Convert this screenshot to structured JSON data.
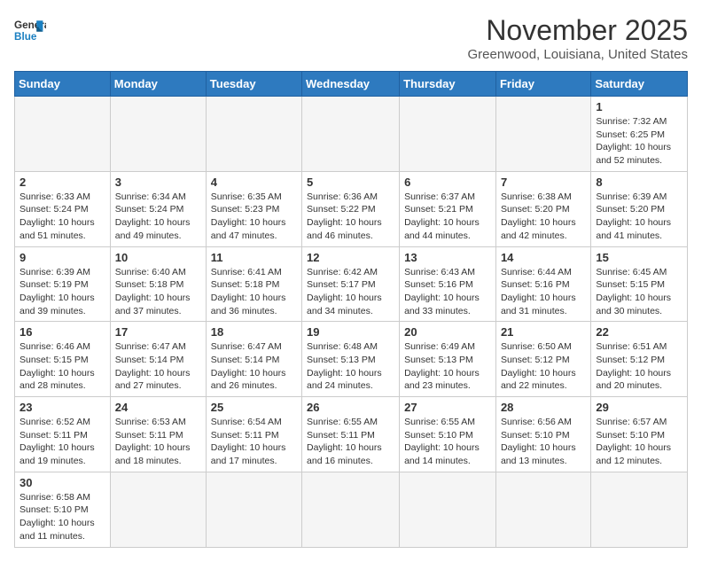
{
  "logo": {
    "line1": "General",
    "line2": "Blue"
  },
  "title": "November 2025",
  "subtitle": "Greenwood, Louisiana, United States",
  "days_of_week": [
    "Sunday",
    "Monday",
    "Tuesday",
    "Wednesday",
    "Thursday",
    "Friday",
    "Saturday"
  ],
  "weeks": [
    [
      {
        "num": "",
        "info": ""
      },
      {
        "num": "",
        "info": ""
      },
      {
        "num": "",
        "info": ""
      },
      {
        "num": "",
        "info": ""
      },
      {
        "num": "",
        "info": ""
      },
      {
        "num": "",
        "info": ""
      },
      {
        "num": "1",
        "info": "Sunrise: 7:32 AM\nSunset: 6:25 PM\nDaylight: 10 hours and 52 minutes."
      }
    ],
    [
      {
        "num": "2",
        "info": "Sunrise: 6:33 AM\nSunset: 5:24 PM\nDaylight: 10 hours and 51 minutes."
      },
      {
        "num": "3",
        "info": "Sunrise: 6:34 AM\nSunset: 5:24 PM\nDaylight: 10 hours and 49 minutes."
      },
      {
        "num": "4",
        "info": "Sunrise: 6:35 AM\nSunset: 5:23 PM\nDaylight: 10 hours and 47 minutes."
      },
      {
        "num": "5",
        "info": "Sunrise: 6:36 AM\nSunset: 5:22 PM\nDaylight: 10 hours and 46 minutes."
      },
      {
        "num": "6",
        "info": "Sunrise: 6:37 AM\nSunset: 5:21 PM\nDaylight: 10 hours and 44 minutes."
      },
      {
        "num": "7",
        "info": "Sunrise: 6:38 AM\nSunset: 5:20 PM\nDaylight: 10 hours and 42 minutes."
      },
      {
        "num": "8",
        "info": "Sunrise: 6:39 AM\nSunset: 5:20 PM\nDaylight: 10 hours and 41 minutes."
      }
    ],
    [
      {
        "num": "9",
        "info": "Sunrise: 6:39 AM\nSunset: 5:19 PM\nDaylight: 10 hours and 39 minutes."
      },
      {
        "num": "10",
        "info": "Sunrise: 6:40 AM\nSunset: 5:18 PM\nDaylight: 10 hours and 37 minutes."
      },
      {
        "num": "11",
        "info": "Sunrise: 6:41 AM\nSunset: 5:18 PM\nDaylight: 10 hours and 36 minutes."
      },
      {
        "num": "12",
        "info": "Sunrise: 6:42 AM\nSunset: 5:17 PM\nDaylight: 10 hours and 34 minutes."
      },
      {
        "num": "13",
        "info": "Sunrise: 6:43 AM\nSunset: 5:16 PM\nDaylight: 10 hours and 33 minutes."
      },
      {
        "num": "14",
        "info": "Sunrise: 6:44 AM\nSunset: 5:16 PM\nDaylight: 10 hours and 31 minutes."
      },
      {
        "num": "15",
        "info": "Sunrise: 6:45 AM\nSunset: 5:15 PM\nDaylight: 10 hours and 30 minutes."
      }
    ],
    [
      {
        "num": "16",
        "info": "Sunrise: 6:46 AM\nSunset: 5:15 PM\nDaylight: 10 hours and 28 minutes."
      },
      {
        "num": "17",
        "info": "Sunrise: 6:47 AM\nSunset: 5:14 PM\nDaylight: 10 hours and 27 minutes."
      },
      {
        "num": "18",
        "info": "Sunrise: 6:47 AM\nSunset: 5:14 PM\nDaylight: 10 hours and 26 minutes."
      },
      {
        "num": "19",
        "info": "Sunrise: 6:48 AM\nSunset: 5:13 PM\nDaylight: 10 hours and 24 minutes."
      },
      {
        "num": "20",
        "info": "Sunrise: 6:49 AM\nSunset: 5:13 PM\nDaylight: 10 hours and 23 minutes."
      },
      {
        "num": "21",
        "info": "Sunrise: 6:50 AM\nSunset: 5:12 PM\nDaylight: 10 hours and 22 minutes."
      },
      {
        "num": "22",
        "info": "Sunrise: 6:51 AM\nSunset: 5:12 PM\nDaylight: 10 hours and 20 minutes."
      }
    ],
    [
      {
        "num": "23",
        "info": "Sunrise: 6:52 AM\nSunset: 5:11 PM\nDaylight: 10 hours and 19 minutes."
      },
      {
        "num": "24",
        "info": "Sunrise: 6:53 AM\nSunset: 5:11 PM\nDaylight: 10 hours and 18 minutes."
      },
      {
        "num": "25",
        "info": "Sunrise: 6:54 AM\nSunset: 5:11 PM\nDaylight: 10 hours and 17 minutes."
      },
      {
        "num": "26",
        "info": "Sunrise: 6:55 AM\nSunset: 5:11 PM\nDaylight: 10 hours and 16 minutes."
      },
      {
        "num": "27",
        "info": "Sunrise: 6:55 AM\nSunset: 5:10 PM\nDaylight: 10 hours and 14 minutes."
      },
      {
        "num": "28",
        "info": "Sunrise: 6:56 AM\nSunset: 5:10 PM\nDaylight: 10 hours and 13 minutes."
      },
      {
        "num": "29",
        "info": "Sunrise: 6:57 AM\nSunset: 5:10 PM\nDaylight: 10 hours and 12 minutes."
      }
    ],
    [
      {
        "num": "30",
        "info": "Sunrise: 6:58 AM\nSunset: 5:10 PM\nDaylight: 10 hours and 11 minutes."
      },
      {
        "num": "",
        "info": ""
      },
      {
        "num": "",
        "info": ""
      },
      {
        "num": "",
        "info": ""
      },
      {
        "num": "",
        "info": ""
      },
      {
        "num": "",
        "info": ""
      },
      {
        "num": "",
        "info": ""
      }
    ]
  ]
}
